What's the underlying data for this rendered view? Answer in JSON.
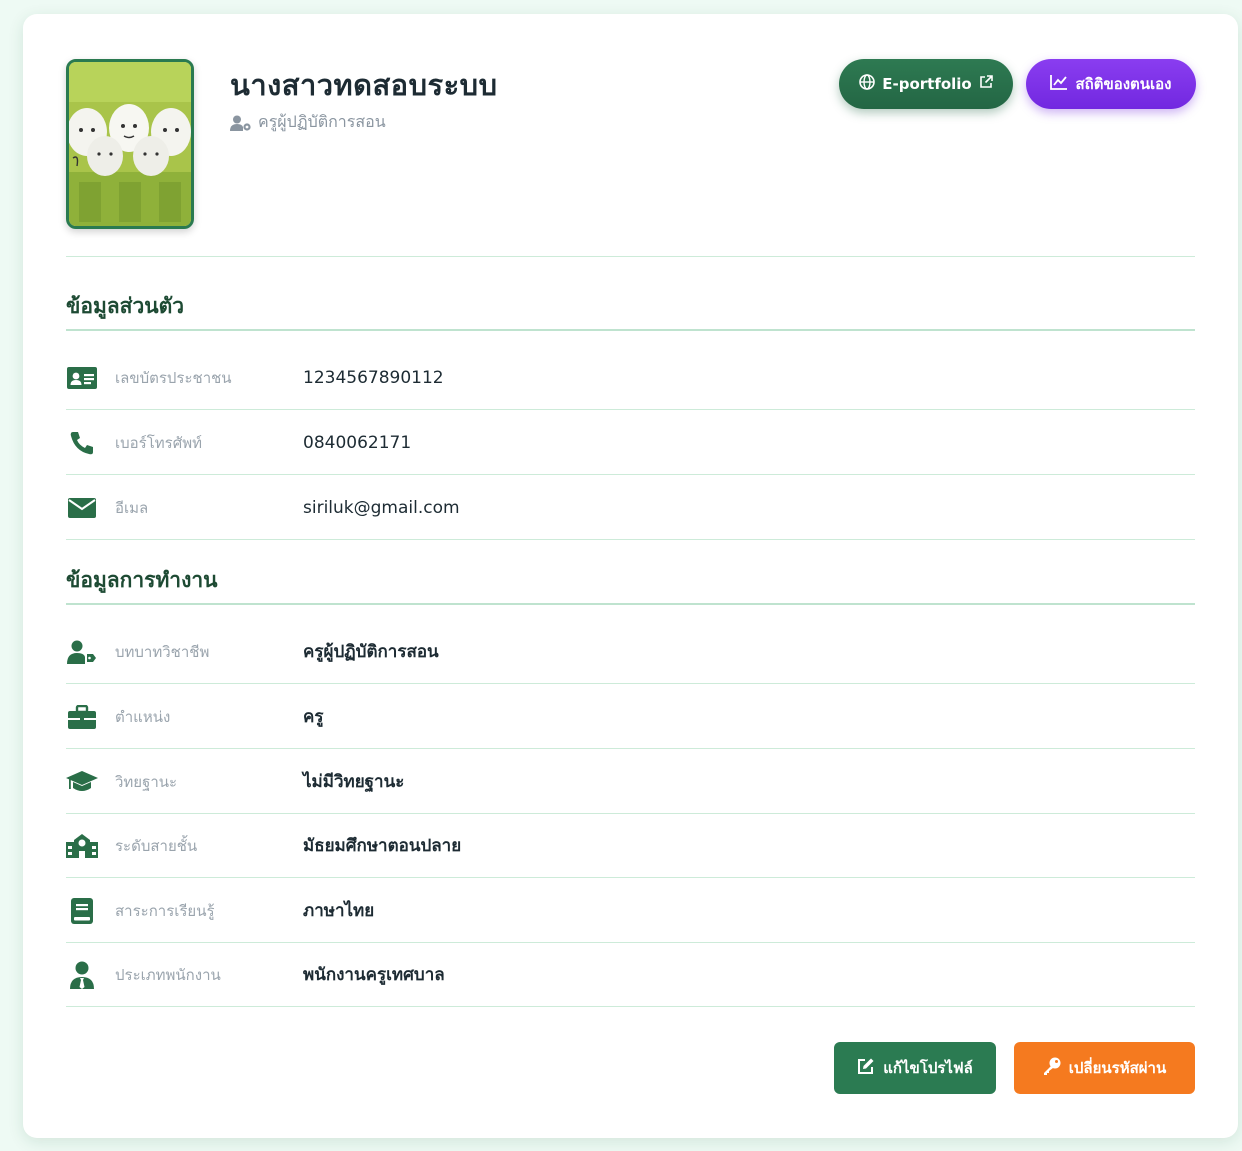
{
  "profile": {
    "name": "นางสาวทดสอบระบบ",
    "role": "ครูผู้ปฏิบัติการสอน",
    "avatar_alt": "profile photo"
  },
  "header_buttons": {
    "eportfolio_label": "E-portfolio",
    "stats_label": "สถิติของตนเอง"
  },
  "personal": {
    "title": "ข้อมูลส่วนตัว",
    "rows": [
      {
        "icon": "id-card-icon",
        "label": "เลขบัตรประชาชน",
        "value": "1234567890112"
      },
      {
        "icon": "phone-icon",
        "label": "เบอร์โทรศัพท์",
        "value": "0840062171"
      },
      {
        "icon": "envelope-icon",
        "label": "อีเมล",
        "value": "siriluk@gmail.com"
      }
    ]
  },
  "work": {
    "title": "ข้อมูลการทำงาน",
    "rows": [
      {
        "icon": "user-tag-icon",
        "label": "บทบาทวิชาชีพ",
        "value": "ครูผู้ปฏิบัติการสอน"
      },
      {
        "icon": "briefcase-icon",
        "label": "ตำแหน่ง",
        "value": "ครู"
      },
      {
        "icon": "graduation-cap-icon",
        "label": "วิทยฐานะ",
        "value": "ไม่มีวิทยฐานะ"
      },
      {
        "icon": "school-icon",
        "label": "ระดับสายชั้น",
        "value": "มัธยมศึกษาตอนปลาย"
      },
      {
        "icon": "book-icon",
        "label": "สาระการเรียนรู้",
        "value": "ภาษาไทย"
      },
      {
        "icon": "user-tie-icon",
        "label": "ประเภทพนักงาน",
        "value": "พนักงานครูเทศบาล"
      }
    ]
  },
  "footer_buttons": {
    "edit_label": "แก้ไขโปรไฟล์",
    "password_label": "เปลี่ยนรหัสผ่าน"
  },
  "colors": {
    "primary_green": "#2b7b52",
    "purple": "#7a2fe6",
    "orange": "#f57a1f",
    "icon_green": "#2a6e48"
  }
}
